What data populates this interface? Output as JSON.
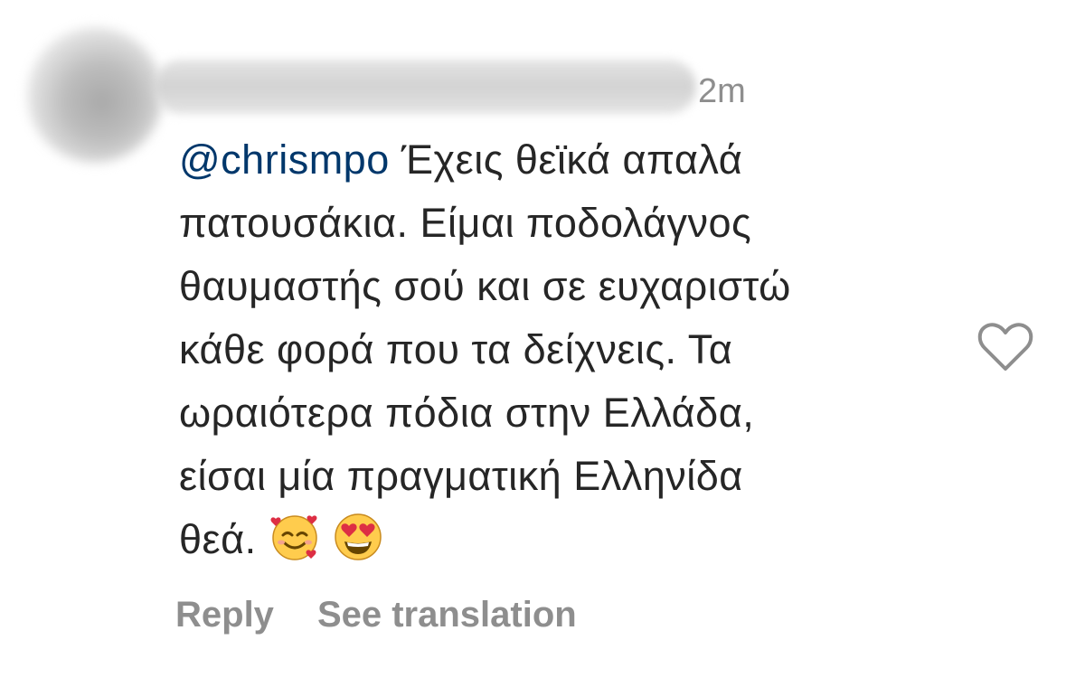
{
  "comment": {
    "timestamp": "2m",
    "mention": "@chrismpo",
    "lines": [
      " Έχεις θεϊκά απαλά",
      "πατουσάκια. Είμαι ποδολάγνος",
      "θαυμαστής σού και σε ευχαριστώ",
      "κάθε φορά που τα δείχνεις. Τα",
      "ωραιότερα πόδια στην Ελλάδα,",
      "είσαι μία πραγματική Ελληνίδα",
      "θεά."
    ],
    "emojis": [
      "smiling-face-with-hearts-icon",
      "heart-eyes-icon"
    ]
  },
  "actions": {
    "reply_label": "Reply",
    "translate_label": "See translation"
  },
  "like": {
    "icon": "heart-outline-icon"
  },
  "colors": {
    "text": "#262626",
    "muted": "#8e8e8e",
    "mention": "#00376b",
    "emoji_face": "#ffcc4d",
    "emoji_heart": "#dd2e44"
  }
}
